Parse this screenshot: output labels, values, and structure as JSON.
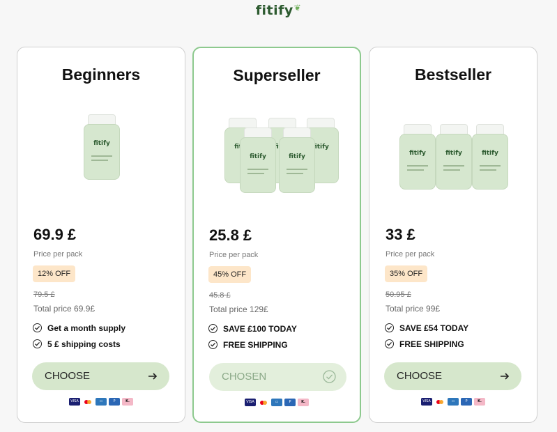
{
  "brand": {
    "name": "fitify"
  },
  "plans": [
    {
      "title": "Beginners",
      "price": "69.9 £",
      "price_note": "Price per pack",
      "discount": "12% OFF",
      "old_price": "79.5 £",
      "total": "Total price 69.9£",
      "features": [
        "Get a month supply",
        "5 £ shipping costs"
      ],
      "button": "CHOOSE",
      "selected": false
    },
    {
      "title": "Superseller",
      "price": "25.8 £",
      "price_note": "Price per pack",
      "discount": "45% OFF",
      "old_price": "45.8 £",
      "total": "Total price 129£",
      "features": [
        "SAVE £100 TODAY",
        "FREE SHIPPING"
      ],
      "button": "CHOSEN",
      "selected": true
    },
    {
      "title": "Bestseller",
      "price": "33 £",
      "price_note": "Price per pack",
      "discount": "35% OFF",
      "old_price": "50.95 £",
      "total": "Total price 99£",
      "features": [
        "SAVE £54 TODAY",
        "FREE SHIPPING"
      ],
      "button": "CHOOSE",
      "selected": false
    }
  ],
  "payments": {
    "visa": "VISA",
    "klarna": "K."
  },
  "icons": [
    "check-circle-icon",
    "arrow-right-icon",
    "checkmark-circle-icon"
  ],
  "colors": {
    "accent": "#d6e7cc",
    "selected_border": "#8dc98e",
    "badge": "#fde6c9",
    "brand": "#2c5a2f"
  }
}
